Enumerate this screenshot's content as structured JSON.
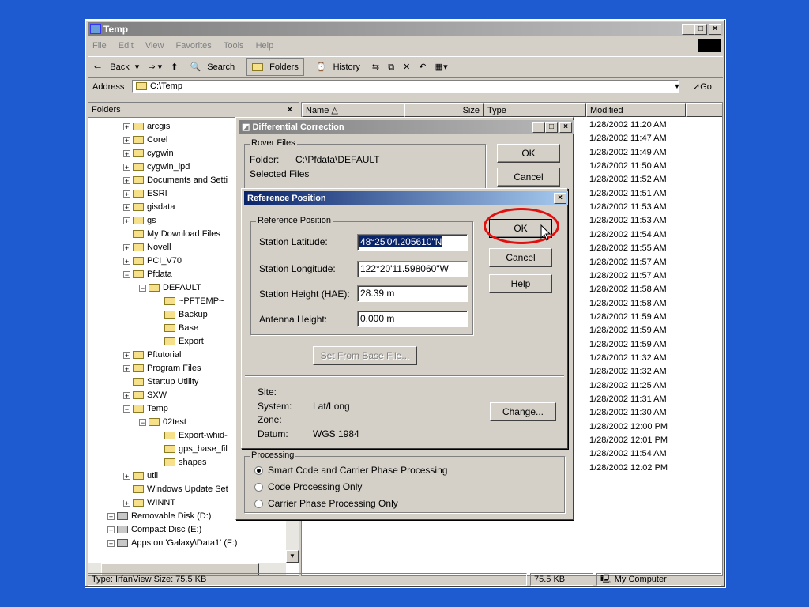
{
  "window": {
    "title": "Temp",
    "menu": [
      "File",
      "Edit",
      "View",
      "Favorites",
      "Tools",
      "Help"
    ],
    "toolbar": {
      "back": "Back",
      "search": "Search",
      "folders": "Folders",
      "history": "History"
    },
    "address": {
      "label": "Address",
      "value": "C:\\Temp",
      "go": "Go"
    }
  },
  "folders": {
    "header": "Folders",
    "close": "×",
    "items": [
      {
        "label": "arcgis",
        "level": 2,
        "expander": "+"
      },
      {
        "label": "Corel",
        "level": 2,
        "expander": "+"
      },
      {
        "label": "cygwin",
        "level": 2,
        "expander": "+"
      },
      {
        "label": "cygwin_lpd",
        "level": 2,
        "expander": "+"
      },
      {
        "label": "Documents and Setti",
        "level": 2,
        "expander": "+"
      },
      {
        "label": "ESRI",
        "level": 2,
        "expander": "+"
      },
      {
        "label": "gisdata",
        "level": 2,
        "expander": "+"
      },
      {
        "label": "gs",
        "level": 2,
        "expander": "+"
      },
      {
        "label": "My Download Files",
        "level": 2,
        "expander": ""
      },
      {
        "label": "Novell",
        "level": 2,
        "expander": "+"
      },
      {
        "label": "PCI_V70",
        "level": 2,
        "expander": "+"
      },
      {
        "label": "Pfdata",
        "level": 2,
        "expander": "−"
      },
      {
        "label": "DEFAULT",
        "level": 3,
        "expander": "−"
      },
      {
        "label": "~PFTEMP~",
        "level": 4,
        "expander": ""
      },
      {
        "label": "Backup",
        "level": 4,
        "expander": ""
      },
      {
        "label": "Base",
        "level": 4,
        "expander": ""
      },
      {
        "label": "Export",
        "level": 4,
        "expander": ""
      },
      {
        "label": "Pftutorial",
        "level": 2,
        "expander": "+"
      },
      {
        "label": "Program Files",
        "level": 2,
        "expander": "+"
      },
      {
        "label": "Startup Utility",
        "level": 2,
        "expander": ""
      },
      {
        "label": "SXW",
        "level": 2,
        "expander": "+"
      },
      {
        "label": "Temp",
        "level": 2,
        "expander": "−"
      },
      {
        "label": "02test",
        "level": 3,
        "expander": "−"
      },
      {
        "label": "Export-whid-",
        "level": 4,
        "expander": ""
      },
      {
        "label": "gps_base_fil",
        "level": 4,
        "expander": ""
      },
      {
        "label": "shapes",
        "level": 4,
        "expander": ""
      },
      {
        "label": "util",
        "level": 2,
        "expander": "+"
      },
      {
        "label": "Windows Update Set",
        "level": 2,
        "expander": ""
      },
      {
        "label": "WINNT",
        "level": 2,
        "expander": "+"
      },
      {
        "label": "Removable Disk (D:)",
        "level": 1,
        "expander": "+"
      },
      {
        "label": "Compact Disc (E:)",
        "level": 1,
        "expander": "+"
      },
      {
        "label": "Apps on 'Galaxy\\Data1' (F:)",
        "level": 1,
        "expander": "+"
      }
    ]
  },
  "filelist": {
    "columns": [
      "Name",
      "Size",
      "Type",
      "Modified"
    ],
    "modified": [
      "1/28/2002 11:20 AM",
      "1/28/2002 11:47 AM",
      "1/28/2002 11:49 AM",
      "1/28/2002 11:50 AM",
      "1/28/2002 11:52 AM",
      "1/28/2002 11:51 AM",
      "1/28/2002 11:53 AM",
      "1/28/2002 11:53 AM",
      "1/28/2002 11:54 AM",
      "1/28/2002 11:55 AM",
      "1/28/2002 11:57 AM",
      "1/28/2002 11:57 AM",
      "1/28/2002 11:58 AM",
      "1/28/2002 11:58 AM",
      "1/28/2002 11:59 AM",
      "1/28/2002 11:59 AM",
      "1/28/2002 11:59 AM",
      "1/28/2002 11:32 AM",
      "1/28/2002 11:32 AM",
      "1/28/2002 11:25 AM",
      "1/28/2002 11:31 AM",
      "1/28/2002 11:30 AM",
      "1/28/2002 12:00 PM",
      "1/28/2002 12:01 PM",
      "1/28/2002 11:54 AM",
      "1/28/2002 12:02 PM"
    ]
  },
  "statusbar": {
    "left": "Type: IrfanView Size: 75.5 KB",
    "size": "75.5 KB",
    "zone": "My Computer"
  },
  "diffdlg": {
    "title": "Differential Correction",
    "rover_group": "Rover Files",
    "folder_label": "Folder:",
    "folder_value": "C:\\Pfdata\\DEFAULT",
    "selected_label": "Selected Files",
    "ok": "OK",
    "cancel": "Cancel",
    "processing_group": "Processing",
    "options": [
      "Smart Code and Carrier Phase Processing",
      "Code Processing Only",
      "Carrier Phase Processing Only"
    ],
    "selected_option": 0
  },
  "refdlg": {
    "title": "Reference Position",
    "group": "Reference Position",
    "lat_label": "Station Latitude:",
    "lat_value": "48°25'04.205610\"N",
    "lon_label": "Station Longitude:",
    "lon_value": "122°20'11.598060\"W",
    "height_label": "Station Height (HAE):",
    "height_value": "28.39 m",
    "antenna_label": "Antenna Height:",
    "antenna_value": "0.000 m",
    "set_from_base": "Set From Base File...",
    "site_label": "Site:",
    "system_label": "System:",
    "system_value": "Lat/Long",
    "zone_label": "Zone:",
    "datum_label": "Datum:",
    "datum_value": "WGS 1984",
    "ok": "OK",
    "cancel": "Cancel",
    "help": "Help",
    "change": "Change..."
  },
  "colors": {
    "desktop": "#1e5bd1",
    "highlight": "#0a246a",
    "annotation": "#e01010"
  }
}
